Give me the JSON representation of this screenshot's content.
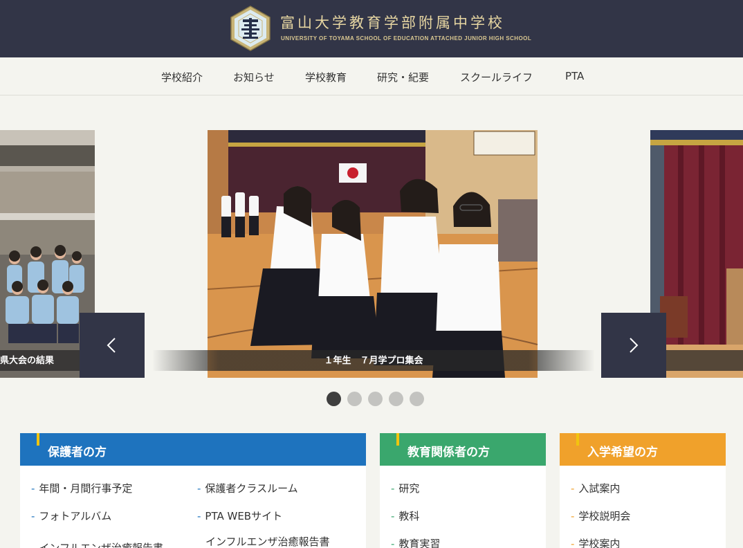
{
  "header": {
    "title": "富山大学教育学部附属中学校",
    "subtitle": "UNIVERSITY OF TOYAMA SCHOOL OF EDUCATION ATTACHED JUNIOR HIGH SCHOOL",
    "emblem_icon": "school-emblem"
  },
  "nav": {
    "items": [
      "学校紹介",
      "お知らせ",
      "学校教育",
      "研究・紀要",
      "スクールライフ",
      "PTA"
    ]
  },
  "carousel": {
    "left_caption": "県大会の結果",
    "center_caption": "１年生　７月学プロ集会",
    "prev_icon": "chevron-left-icon",
    "next_icon": "chevron-right-icon",
    "dot_count": 5,
    "active_dot": 1
  },
  "panels": {
    "parents": {
      "title": "保護者の方",
      "color": "#1e73be",
      "col1": [
        "年間・月間行事予定",
        "フォトアルバム",
        "インフルエンザ治癒報告書"
      ],
      "col2": [
        "保護者クラスルーム",
        "PTA WEBサイト",
        "インフルエンザ治癒報告書"
      ]
    },
    "educators": {
      "title": "教育関係者の方",
      "color": "#3aa76d",
      "links": [
        "研究",
        "教科",
        "教育実習"
      ]
    },
    "applicants": {
      "title": "入学希望の方",
      "color": "#f0a12b",
      "links": [
        "入試案内",
        "学校説明会",
        "学校案内"
      ]
    }
  },
  "colors": {
    "header_bg": "#323547",
    "gold": "#e7d6a2",
    "page_bg": "#f4f4ef"
  }
}
